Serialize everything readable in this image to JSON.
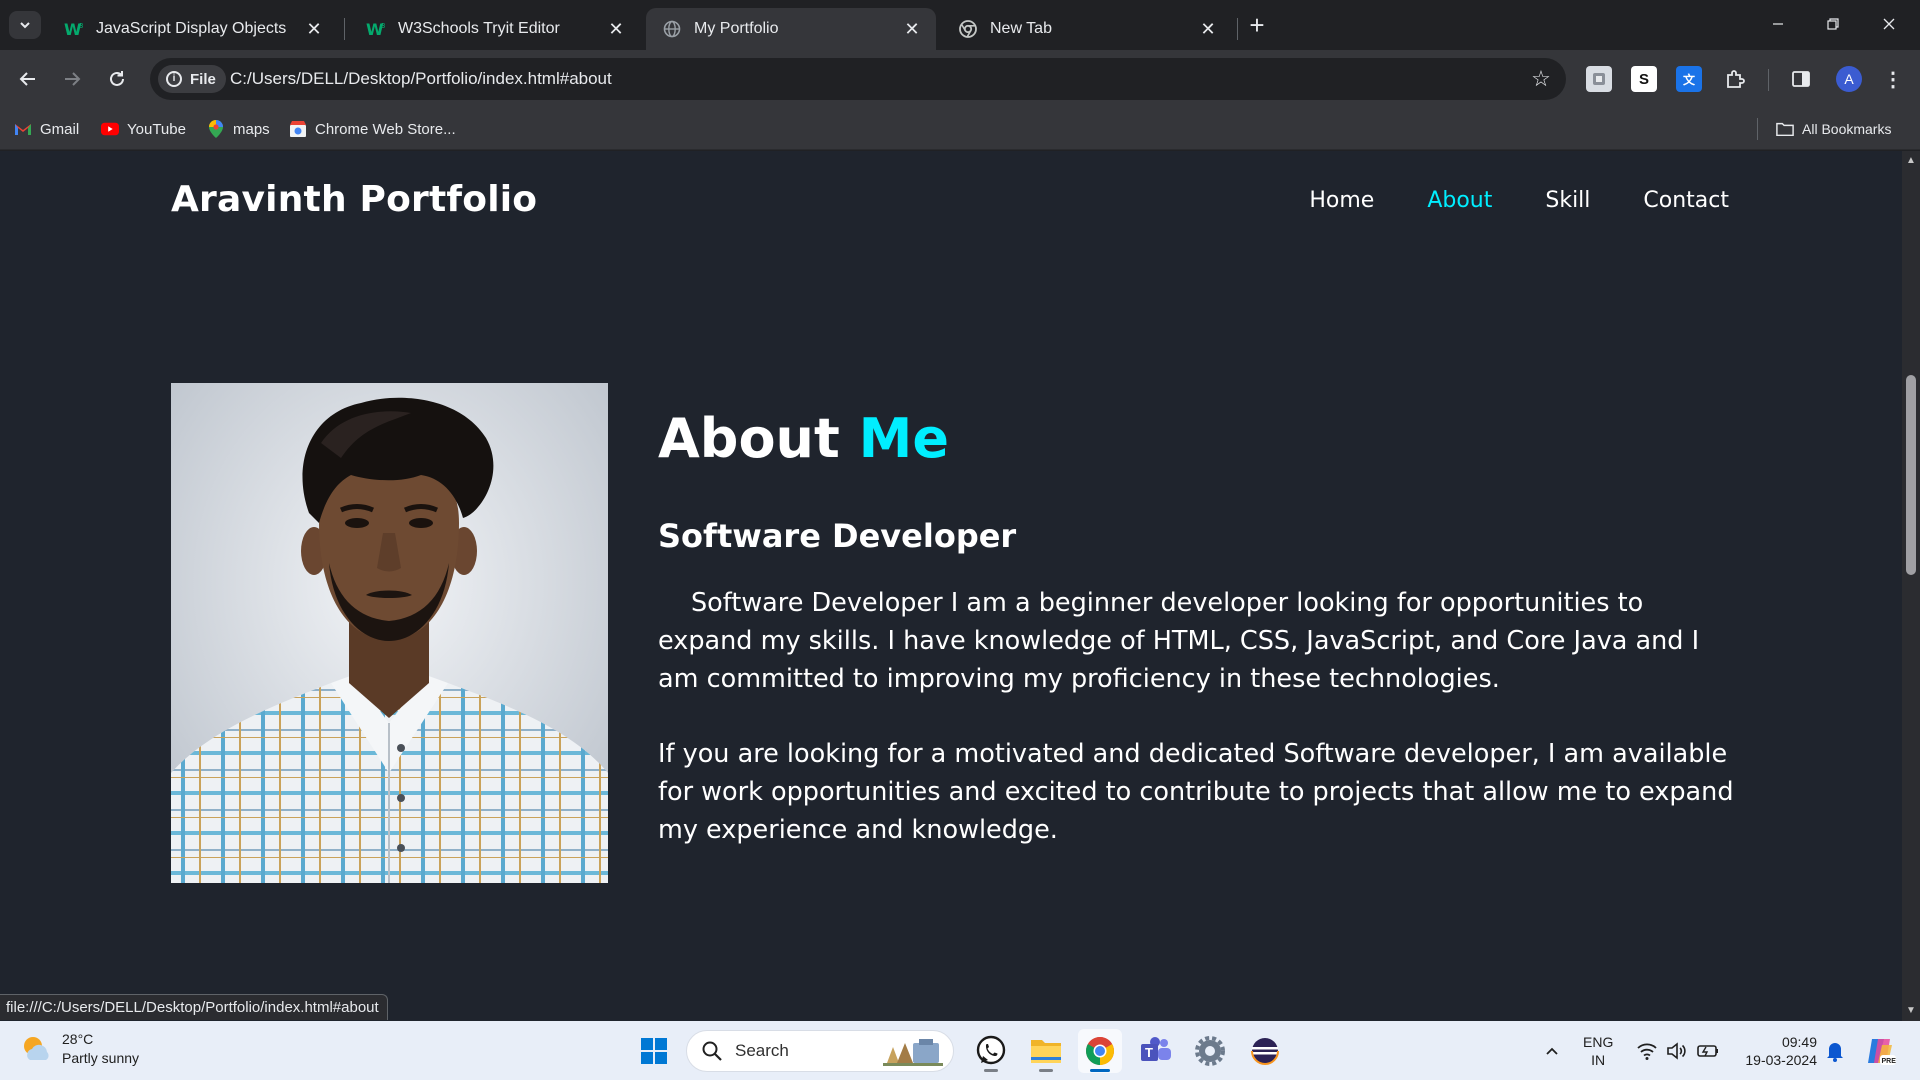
{
  "browser": {
    "tabs": [
      {
        "title": "JavaScript Display Objects",
        "active": false
      },
      {
        "title": "W3Schools Tryit Editor",
        "active": false
      },
      {
        "title": "My Portfolio",
        "active": true
      },
      {
        "title": "New Tab",
        "active": false
      }
    ],
    "address": {
      "chip_label": "File",
      "url": "C:/Users/DELL/Desktop/Portfolio/index.html#about"
    },
    "profile_initial": "A",
    "bookmarks": [
      {
        "label": "Gmail"
      },
      {
        "label": "YouTube"
      },
      {
        "label": "maps"
      },
      {
        "label": "Chrome Web Store..."
      }
    ],
    "all_bookmarks_label": "All Bookmarks",
    "status_url": "file:///C:/Users/DELL/Desktop/Portfolio/index.html#about"
  },
  "page": {
    "logo": "Aravinth Portfolio",
    "nav": [
      {
        "label": "Home",
        "active": false
      },
      {
        "label": "About",
        "active": true
      },
      {
        "label": "Skill",
        "active": false
      },
      {
        "label": "Contact",
        "active": false
      }
    ],
    "about": {
      "heading_main": "About",
      "heading_accent": "Me",
      "subtitle": "Software Developer",
      "paragraph1": "Software Developer I am a beginner developer looking for opportunities to expand my skills. I have knowledge of HTML, CSS, JavaScript, and Core Java and I am committed to improving my proficiency in these technologies.",
      "paragraph2": "If you are looking for a motivated and dedicated Software developer, I am available for work opportunities and excited to contribute to projects that allow me to expand my experience and knowledge."
    },
    "accent_color": "#00eeff",
    "background_color": "#1f242d"
  },
  "taskbar": {
    "weather": {
      "temp": "28°C",
      "condition": "Partly sunny"
    },
    "search_placeholder": "Search",
    "language": {
      "line1": "ENG",
      "line2": "IN"
    },
    "clock": {
      "time": "09:49",
      "date": "19-03-2024"
    }
  }
}
